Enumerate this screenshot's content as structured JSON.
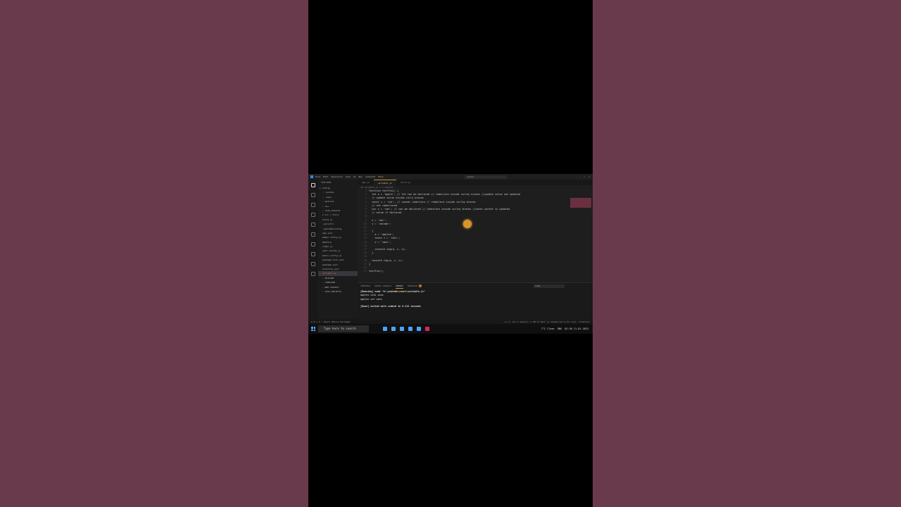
{
  "window": {
    "menu": [
      "File",
      "Edit",
      "Selection",
      "View",
      "Go",
      "Run",
      "Terminal",
      "Help"
    ],
    "search_placeholder": "Rydom",
    "controls": [
      "—",
      "☐",
      "✕"
    ]
  },
  "explorer": {
    "title": "EXPLORER",
    "items": [
      "▸ coding",
      "› .bundle",
      "› .expo",
      "› android",
      "› ios",
      "› node_modules",
      "∨ src / utils",
      "Child.js",
      ".eslintrc",
      ".watchmanconfig",
      "app.json",
      "babel.config.js",
      "Gemfile",
      "index.js",
      "jest.config.js",
      "metro.config.js",
      "package-lock.json",
      "package.json",
      "tsconfig.json",
      "variable.js",
      "› OUTLINE",
      "› TIMELINE",
      "› NPM SCRIPTS",
      "› JAVA PROJECTS"
    ],
    "selected_index": 19
  },
  "tabs": [
    "App.js",
    "variable.js",
    "child.js"
  ],
  "breadcrumb": "JS variable.js > ⊙ testfun",
  "code_lines": [
    "function testfun() {",
    "  let a = 'apple'; // let can be declared // redeclare inside curley braces //update value not updated",
    "  // update value inside curly braces",
    "  const c = 'cat'; // cannot redeclare // redeclare inside curley braces",
    "  // not redeclared",
    "  var v = 'van'; // can be declared // redeclare inside curley braces //outer parent is updated",
    "  // value if declared",
    "",
    "  a = 'ant';",
    "  v = 'volume';",
    "",
    "  {",
    "    a = 'apples';",
    "    const c = 'cats';",
    "    v = 'vans';",
    "",
    "    console.log(a, c, v);",
    "  }",
    "",
    "  console.log(a, c, v);",
    "}",
    "",
    "testfun();"
  ],
  "panel": {
    "tabs": [
      "TERMINAL",
      "DEBUG CONSOLE",
      "OUTPUT",
      "PROBLEMS"
    ],
    "problems_count": "2",
    "filter_value": "Code",
    "output": [
      "[Running] node \"d:\\youtube\\react\\variable.js\"",
      "apples cats vans",
      "apples cat vans",
      "",
      "[Done] exited with code=0 in 0.111 seconds"
    ]
  },
  "statusbar": {
    "left": "⊗ 0 ⚠ 0  ⚡ React Native Packager",
    "right": "Ln 2, Col 1  Spaces: 4  UTF-8  CRLF  {} JavaScript  ◎ Go Live  ✓ Prettier"
  },
  "taskbar": {
    "search_placeholder": "Type here to search",
    "weather": "7°C Clear",
    "lang": "ENG",
    "time": "02:36",
    "date": "21-01-2023"
  }
}
